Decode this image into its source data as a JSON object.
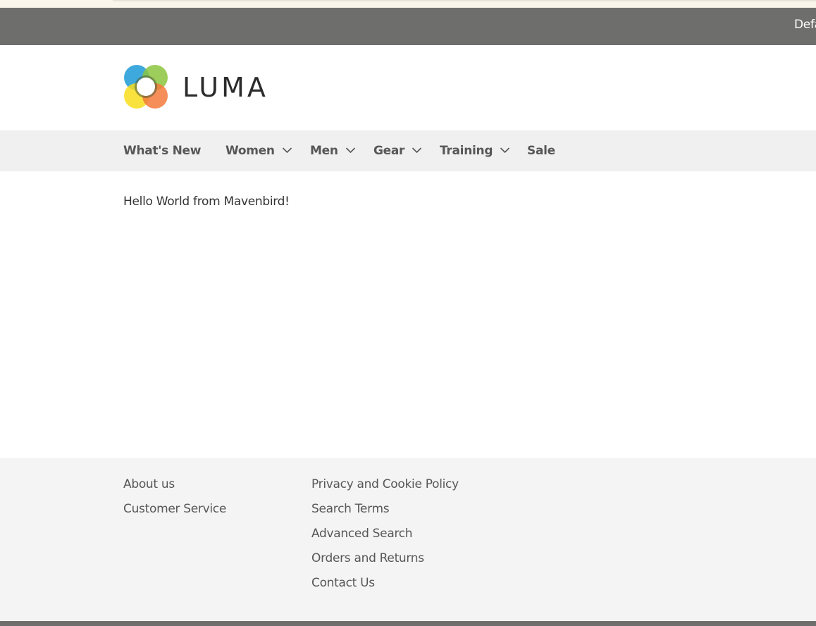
{
  "top_bar": {
    "store_switcher_label": "Defa"
  },
  "header": {
    "logo_text": "LUMA"
  },
  "nav": {
    "items": [
      {
        "label": "What's New",
        "has_submenu": false
      },
      {
        "label": "Women",
        "has_submenu": true
      },
      {
        "label": "Men",
        "has_submenu": true
      },
      {
        "label": "Gear",
        "has_submenu": true
      },
      {
        "label": "Training",
        "has_submenu": true
      },
      {
        "label": "Sale",
        "has_submenu": false
      }
    ]
  },
  "main": {
    "message": "Hello World from Mavenbird!"
  },
  "footer": {
    "column_1": [
      "About us",
      "Customer Service"
    ],
    "column_2": [
      "Privacy and Cookie Policy",
      "Search Terms",
      "Advanced Search",
      "Orders and Returns",
      "Contact Us"
    ]
  },
  "colors": {
    "top_bar": "#6e6f6c",
    "nav_background": "#f0f0f0",
    "footer_background": "#f4f4f4",
    "logo_blue": "#1c9ad6",
    "logo_green": "#8cc63f",
    "logo_yellow": "#f8dd1c",
    "logo_orange": "#f37a3b"
  }
}
